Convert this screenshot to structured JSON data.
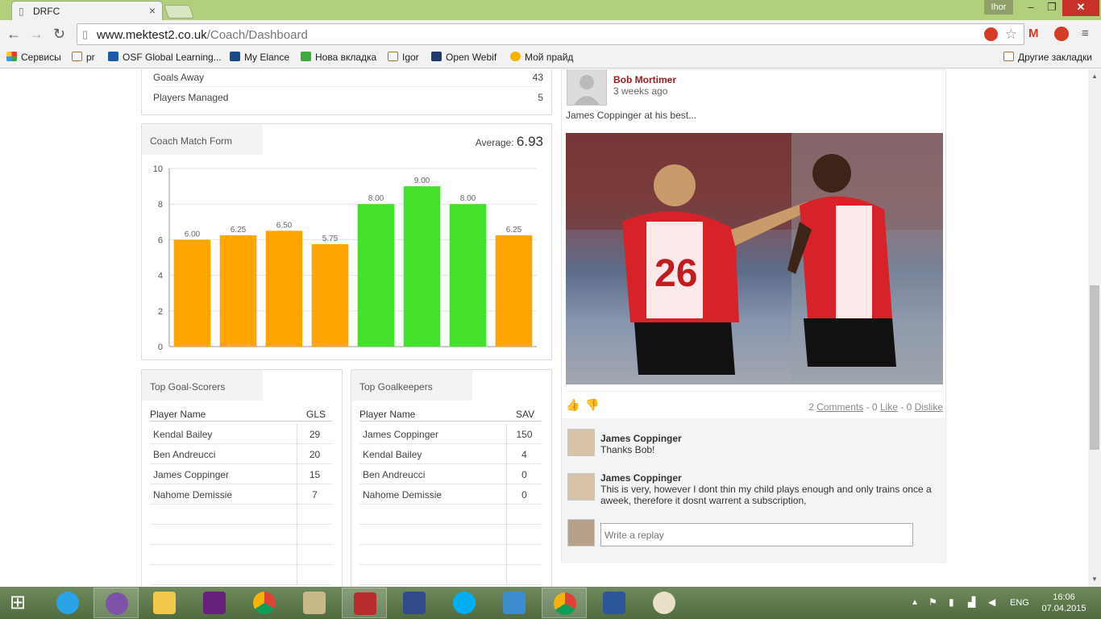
{
  "browser": {
    "tab_title": "DRFC",
    "user": "Ihor",
    "url_host": "www.mektest2.co.uk",
    "url_path": "/Coach/Dashboard",
    "bookmarks": [
      "Сервисы",
      "pr",
      "OSF Global Learning...",
      "My Elance",
      "Нова вкладка",
      "Igor",
      "Open Webif",
      "Мой прайд"
    ],
    "other_bookmarks": "Другие закладки"
  },
  "stats": [
    {
      "label": "Goals Away",
      "value": "43"
    },
    {
      "label": "Players Managed",
      "value": "5"
    }
  ],
  "match_form": {
    "title": "Coach Match Form",
    "average_label": "Average:",
    "average_value": "6.93"
  },
  "chart_data": {
    "type": "bar",
    "values": [
      6.0,
      6.25,
      6.5,
      5.75,
      8.0,
      9.0,
      8.0,
      6.25
    ],
    "labels": [
      "6.00",
      "6.25",
      "6.50",
      "5.75",
      "8.00",
      "9.00",
      "8.00",
      "6.25"
    ],
    "colors": [
      "#ffa500",
      "#ffa500",
      "#ffa500",
      "#ffa500",
      "#44e02c",
      "#44e02c",
      "#44e02c",
      "#ffa500"
    ],
    "ylim": [
      0,
      10
    ],
    "yticks": [
      "0",
      "2",
      "4",
      "6",
      "8",
      "10"
    ],
    "grid": true
  },
  "scorers": {
    "title": "Top Goal-Scorers",
    "col_name": "Player Name",
    "col_value": "GLS",
    "rows": [
      {
        "name": "Kendal Bailey",
        "value": "29"
      },
      {
        "name": "Ben Andreucci",
        "value": "20"
      },
      {
        "name": "James Coppinger",
        "value": "15"
      },
      {
        "name": "Nahome Demissie",
        "value": "7"
      }
    ]
  },
  "keepers": {
    "title": "Top Goalkeepers",
    "col_name": "Player Name",
    "col_value": "SAV",
    "rows": [
      {
        "name": "James Coppinger",
        "value": "150"
      },
      {
        "name": "Kendal Bailey",
        "value": "4"
      },
      {
        "name": "Ben Andreucci",
        "value": "0"
      },
      {
        "name": "Nahome Demissie",
        "value": "0"
      }
    ]
  },
  "post": {
    "author": "Bob Mortimer",
    "time": "3 weeks ago",
    "text": "James Coppinger at his best...",
    "comments_count": "2",
    "comments_label": "Comments",
    "likes_count": "- 0",
    "like_label": "Like",
    "dislikes_count": "- 0",
    "dislike_label": "Dislike"
  },
  "comments": [
    {
      "author": "James Coppinger",
      "text": "Thanks Bob!"
    },
    {
      "author": "James Coppinger",
      "text": "This is very, however I dont thin my child plays enough and only trains once a aweek, therefore it dosnt warrent a subscription,"
    }
  ],
  "reply_placeholder": "Write a replay",
  "taskbar": {
    "lang": "ENG",
    "time": "16:06",
    "date": "07.04.2015"
  }
}
